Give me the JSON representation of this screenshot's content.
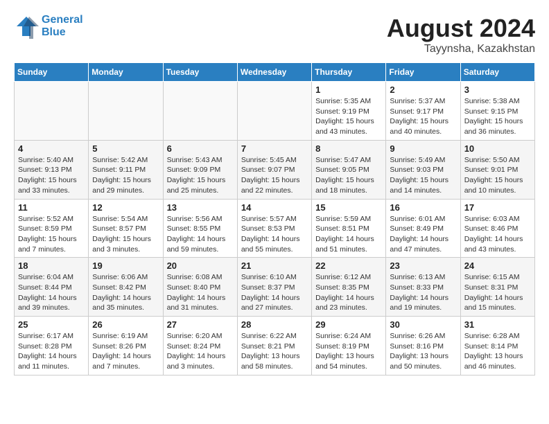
{
  "header": {
    "logo_line1": "General",
    "logo_line2": "Blue",
    "month_year": "August 2024",
    "location": "Tayynsha, Kazakhstan"
  },
  "weekdays": [
    "Sunday",
    "Monday",
    "Tuesday",
    "Wednesday",
    "Thursday",
    "Friday",
    "Saturday"
  ],
  "weeks": [
    [
      {
        "day": "",
        "info": ""
      },
      {
        "day": "",
        "info": ""
      },
      {
        "day": "",
        "info": ""
      },
      {
        "day": "",
        "info": ""
      },
      {
        "day": "1",
        "info": "Sunrise: 5:35 AM\nSunset: 9:19 PM\nDaylight: 15 hours\nand 43 minutes."
      },
      {
        "day": "2",
        "info": "Sunrise: 5:37 AM\nSunset: 9:17 PM\nDaylight: 15 hours\nand 40 minutes."
      },
      {
        "day": "3",
        "info": "Sunrise: 5:38 AM\nSunset: 9:15 PM\nDaylight: 15 hours\nand 36 minutes."
      }
    ],
    [
      {
        "day": "4",
        "info": "Sunrise: 5:40 AM\nSunset: 9:13 PM\nDaylight: 15 hours\nand 33 minutes."
      },
      {
        "day": "5",
        "info": "Sunrise: 5:42 AM\nSunset: 9:11 PM\nDaylight: 15 hours\nand 29 minutes."
      },
      {
        "day": "6",
        "info": "Sunrise: 5:43 AM\nSunset: 9:09 PM\nDaylight: 15 hours\nand 25 minutes."
      },
      {
        "day": "7",
        "info": "Sunrise: 5:45 AM\nSunset: 9:07 PM\nDaylight: 15 hours\nand 22 minutes."
      },
      {
        "day": "8",
        "info": "Sunrise: 5:47 AM\nSunset: 9:05 PM\nDaylight: 15 hours\nand 18 minutes."
      },
      {
        "day": "9",
        "info": "Sunrise: 5:49 AM\nSunset: 9:03 PM\nDaylight: 15 hours\nand 14 minutes."
      },
      {
        "day": "10",
        "info": "Sunrise: 5:50 AM\nSunset: 9:01 PM\nDaylight: 15 hours\nand 10 minutes."
      }
    ],
    [
      {
        "day": "11",
        "info": "Sunrise: 5:52 AM\nSunset: 8:59 PM\nDaylight: 15 hours\nand 7 minutes."
      },
      {
        "day": "12",
        "info": "Sunrise: 5:54 AM\nSunset: 8:57 PM\nDaylight: 15 hours\nand 3 minutes."
      },
      {
        "day": "13",
        "info": "Sunrise: 5:56 AM\nSunset: 8:55 PM\nDaylight: 14 hours\nand 59 minutes."
      },
      {
        "day": "14",
        "info": "Sunrise: 5:57 AM\nSunset: 8:53 PM\nDaylight: 14 hours\nand 55 minutes."
      },
      {
        "day": "15",
        "info": "Sunrise: 5:59 AM\nSunset: 8:51 PM\nDaylight: 14 hours\nand 51 minutes."
      },
      {
        "day": "16",
        "info": "Sunrise: 6:01 AM\nSunset: 8:49 PM\nDaylight: 14 hours\nand 47 minutes."
      },
      {
        "day": "17",
        "info": "Sunrise: 6:03 AM\nSunset: 8:46 PM\nDaylight: 14 hours\nand 43 minutes."
      }
    ],
    [
      {
        "day": "18",
        "info": "Sunrise: 6:04 AM\nSunset: 8:44 PM\nDaylight: 14 hours\nand 39 minutes."
      },
      {
        "day": "19",
        "info": "Sunrise: 6:06 AM\nSunset: 8:42 PM\nDaylight: 14 hours\nand 35 minutes."
      },
      {
        "day": "20",
        "info": "Sunrise: 6:08 AM\nSunset: 8:40 PM\nDaylight: 14 hours\nand 31 minutes."
      },
      {
        "day": "21",
        "info": "Sunrise: 6:10 AM\nSunset: 8:37 PM\nDaylight: 14 hours\nand 27 minutes."
      },
      {
        "day": "22",
        "info": "Sunrise: 6:12 AM\nSunset: 8:35 PM\nDaylight: 14 hours\nand 23 minutes."
      },
      {
        "day": "23",
        "info": "Sunrise: 6:13 AM\nSunset: 8:33 PM\nDaylight: 14 hours\nand 19 minutes."
      },
      {
        "day": "24",
        "info": "Sunrise: 6:15 AM\nSunset: 8:31 PM\nDaylight: 14 hours\nand 15 minutes."
      }
    ],
    [
      {
        "day": "25",
        "info": "Sunrise: 6:17 AM\nSunset: 8:28 PM\nDaylight: 14 hours\nand 11 minutes."
      },
      {
        "day": "26",
        "info": "Sunrise: 6:19 AM\nSunset: 8:26 PM\nDaylight: 14 hours\nand 7 minutes."
      },
      {
        "day": "27",
        "info": "Sunrise: 6:20 AM\nSunset: 8:24 PM\nDaylight: 14 hours\nand 3 minutes."
      },
      {
        "day": "28",
        "info": "Sunrise: 6:22 AM\nSunset: 8:21 PM\nDaylight: 13 hours\nand 58 minutes."
      },
      {
        "day": "29",
        "info": "Sunrise: 6:24 AM\nSunset: 8:19 PM\nDaylight: 13 hours\nand 54 minutes."
      },
      {
        "day": "30",
        "info": "Sunrise: 6:26 AM\nSunset: 8:16 PM\nDaylight: 13 hours\nand 50 minutes."
      },
      {
        "day": "31",
        "info": "Sunrise: 6:28 AM\nSunset: 8:14 PM\nDaylight: 13 hours\nand 46 minutes."
      }
    ]
  ]
}
